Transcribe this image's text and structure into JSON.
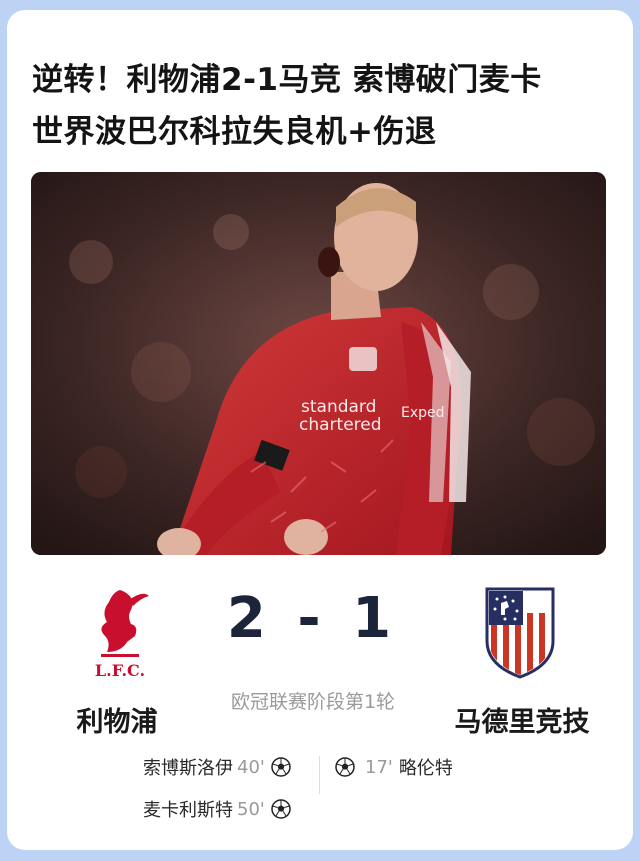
{
  "headline": {
    "line1": "逆转！利物浦2-1马竞 索博破门麦卡",
    "line2": "世界波巴尔科拉失良机+伤退"
  },
  "match": {
    "score": "2 - 1",
    "stage": "欧冠联赛阶段第1轮",
    "home_team": "利物浦",
    "away_team": "马德里竞技",
    "home_crest_text": "L.F.C.",
    "home_scorers": [
      {
        "name": "索博斯洛伊",
        "minute": "40'"
      },
      {
        "name": "麦卡利斯特",
        "minute": "50'"
      }
    ],
    "away_scorers": [
      {
        "name": "略伦特",
        "minute": "17'"
      }
    ]
  },
  "photo": {
    "shirt_sponsor": "Standard Chartered",
    "sleeve_sponsor": "Expedia",
    "crest": "LFC"
  },
  "icons": {
    "goal": "soccer-ball-icon"
  },
  "colors": {
    "background": "#bcd3f5",
    "card": "#ffffff",
    "liverpool_red": "#c8102e",
    "atletico_red": "#cb3524",
    "atletico_blue": "#272e61",
    "score_text": "#1b2438"
  }
}
